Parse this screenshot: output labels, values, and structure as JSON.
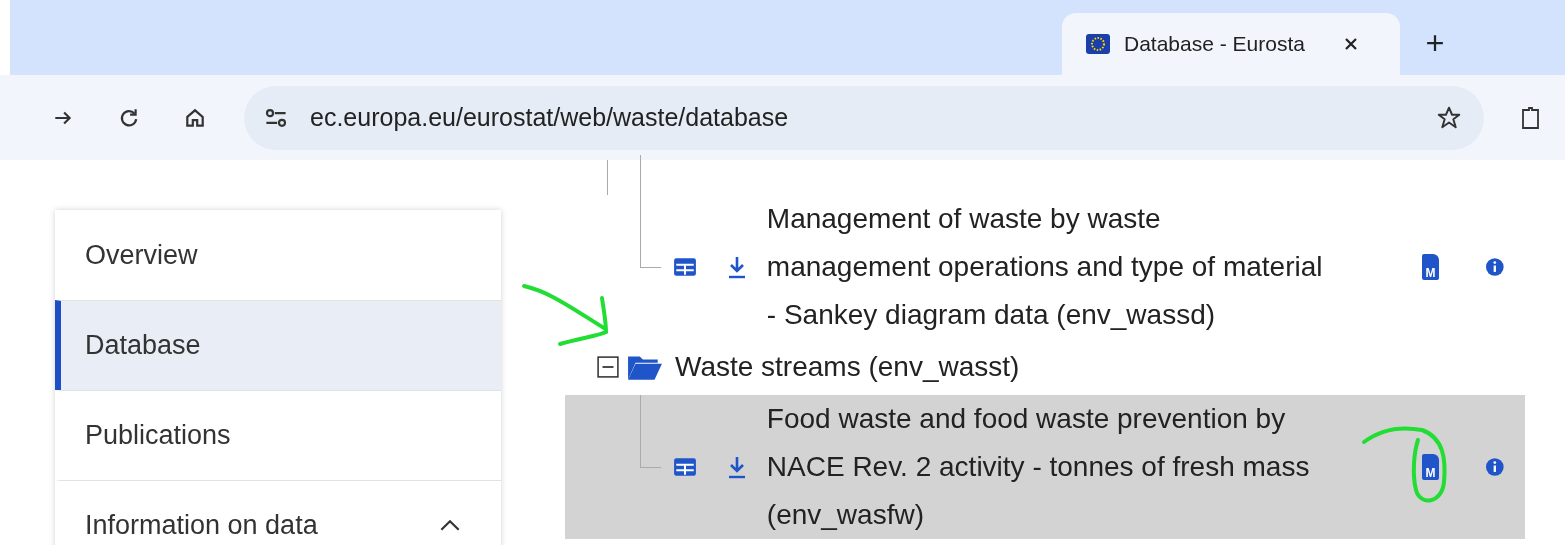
{
  "browser": {
    "tab": {
      "title": "Database - Eurosta",
      "selected": true
    },
    "address": "ec.europa.eu/eurostat/web/waste/database"
  },
  "sidebar": {
    "items": [
      {
        "label": "Overview",
        "selected": false,
        "kind": "link"
      },
      {
        "label": "Database",
        "selected": true,
        "kind": "link"
      },
      {
        "label": "Publications",
        "selected": false,
        "kind": "link"
      },
      {
        "label": "Information on data",
        "selected": false,
        "kind": "group",
        "expanded": true
      }
    ]
  },
  "tree": {
    "items": [
      {
        "kind": "dataset",
        "title_lines": [
          "Management of waste by waste",
          "management operations and type of material",
          "- Sankey diagram data (env_wassd)"
        ],
        "metadata_icon_text": "M",
        "highlighted": false
      },
      {
        "kind": "folder",
        "label": "Waste streams (env_wasst)",
        "expanded": true
      },
      {
        "kind": "dataset",
        "title_lines": [
          "Food waste and food waste prevention by",
          "NACE Rev. 2 activity - tonnes of fresh mass",
          "(env_wasfw)"
        ],
        "metadata_icon_text": "M",
        "highlighted": true
      }
    ]
  }
}
